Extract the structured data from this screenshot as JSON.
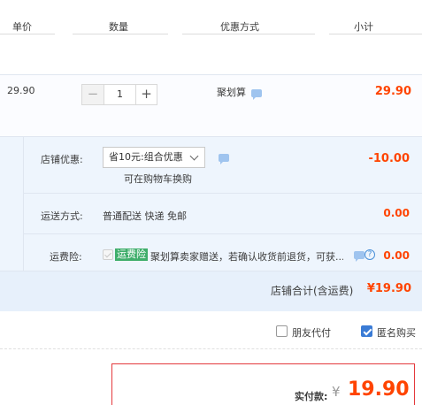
{
  "header": {
    "col_price": "单价",
    "col_qty": "数量",
    "col_promo": "优惠方式",
    "col_subtotal": "小计"
  },
  "product": {
    "price": "29.90",
    "minus": "−",
    "quantity": "1",
    "plus": "+",
    "promo": "聚划算",
    "subtotal": "29.90"
  },
  "shop": {
    "discount_label": "店铺优惠:",
    "discount_select": "省10元:组合优惠",
    "discount_link": "可在购物车换购",
    "discount_amount": "-10.00",
    "shipping_label": "运送方式:",
    "shipping_value": "普通配送 快递 免邮",
    "shipping_amount": "0.00",
    "insurance_label": "运费险:",
    "insurance_tag": "运费险",
    "insurance_text": "聚划算卖家赠送，若确认收货前退货，可获...",
    "insurance_amount": "0.00",
    "total_label": "店铺合计(含运费)",
    "total_amount": "¥19.90"
  },
  "options": {
    "friend_pay": "朋友代付",
    "friend_pay_checked": false,
    "anonymous": "匿名购买",
    "anonymous_checked": true
  },
  "payment": {
    "label": "实付款:",
    "currency": "¥",
    "amount": "19.90"
  },
  "colors": {
    "accent_red": "#ff4400",
    "link_blue": "#3a7bd5",
    "tag_green": "#3fae6b"
  }
}
